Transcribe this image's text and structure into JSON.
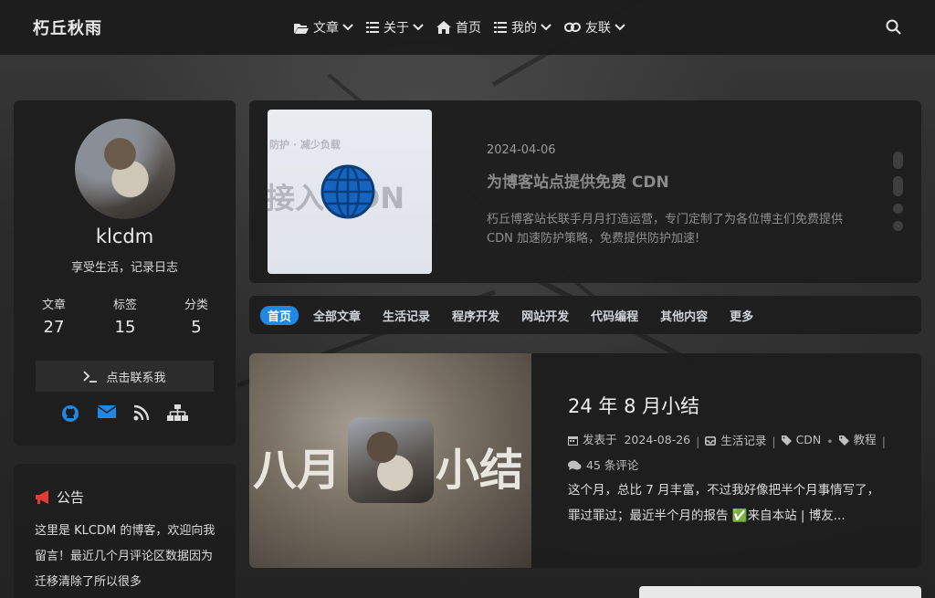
{
  "nav": {
    "brand": "朽丘秋雨",
    "menu": [
      {
        "label": "文章",
        "icon": "folder-open-icon",
        "dropdown": true
      },
      {
        "label": "关于",
        "icon": "list-icon",
        "dropdown": true
      },
      {
        "label": "首页",
        "icon": "home-icon",
        "dropdown": false
      },
      {
        "label": "我的",
        "icon": "list-icon",
        "dropdown": true
      },
      {
        "label": "友联",
        "icon": "link-icon",
        "dropdown": true
      }
    ],
    "search_icon": "search-icon"
  },
  "profile": {
    "name": "klcdm",
    "description": "享受生活，记录日志",
    "stats": [
      {
        "label": "文章",
        "value": "27"
      },
      {
        "label": "标签",
        "value": "15"
      },
      {
        "label": "分类",
        "value": "5"
      }
    ],
    "contact_label": "点击联系我",
    "social": [
      "github-icon",
      "mail-icon",
      "rss-icon",
      "sitemap-icon"
    ],
    "accent": "#1e88e5"
  },
  "notice": {
    "title": "公告",
    "text": "这里是 KLCDM 的博客，欢迎向我留言！最近几个月评论区数据因为迁移清除了所以很多"
  },
  "slider": {
    "date": "2024-04-06",
    "title": "为博客站点提供免费 CDN",
    "excerpt": "朽丘博客站长联手月月打造运营，专门定制了为各位博主们免费提供 CDN 加速防护策略，免费提供防护加速!",
    "image_text_1": "防护 · 减少负载",
    "image_text_2": "接入 CDN"
  },
  "tabs": [
    "首页",
    "全部文章",
    "生活记录",
    "程序开发",
    "网站开发",
    "代码编程",
    "其他内容",
    "更多"
  ],
  "post": {
    "image_left": "八月",
    "image_right": "小结",
    "title": "24 年 8 月小结",
    "posted_label": "发表于",
    "date": "2024-08-26",
    "category": "生活记录",
    "tags": [
      "CDN",
      "教程"
    ],
    "comments": "45 条评论",
    "excerpt": "这个月，总比 7 月丰富，不过我好像把半个月事情写了，罪过罪过；最近半个月的报告 ✅来自本站 | 博友..."
  }
}
